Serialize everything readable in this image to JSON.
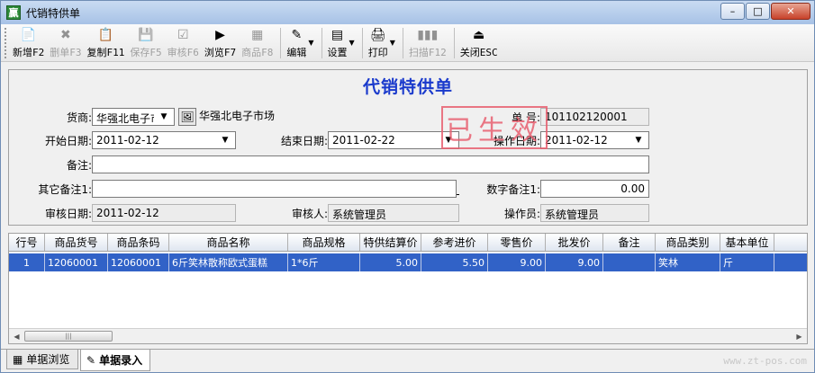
{
  "window": {
    "title": "代销特供单",
    "icon": "贏",
    "controls": {
      "minimize": "–",
      "maximize": "□",
      "close": "✕"
    }
  },
  "toolbar": [
    {
      "label": "新增F2",
      "icon": "📄",
      "enabled": true
    },
    {
      "label": "删单F3",
      "icon": "✖",
      "enabled": false
    },
    {
      "label": "复制F11",
      "icon": "📋",
      "enabled": true
    },
    {
      "label": "保存F5",
      "icon": "💾",
      "enabled": false
    },
    {
      "label": "审核F6",
      "icon": "☑",
      "enabled": false
    },
    {
      "label": "浏览F7",
      "icon": "▶",
      "enabled": true
    },
    {
      "label": "商品F8",
      "icon": "▦",
      "enabled": false
    },
    {
      "label": "编辑",
      "icon": "✎",
      "enabled": true,
      "dropdown": true
    },
    {
      "label": "设置",
      "icon": "▤",
      "enabled": true,
      "dropdown": true
    },
    {
      "label": "打印",
      "icon": "🖨",
      "enabled": true,
      "dropdown": true
    },
    {
      "label": "扫描F12",
      "icon": "▮▮▮",
      "enabled": false
    },
    {
      "label": "关闭ESC",
      "icon": "⏏",
      "enabled": true
    }
  ],
  "form": {
    "title": "代销特供单",
    "supplier_label": "货商:",
    "supplier_value": "华强北电子市",
    "supplier_name": "华强北电子市场",
    "docno_label": "单 号:",
    "docno_value": "101102120001",
    "start_label": "开始日期:",
    "start_value": "2011-02-12",
    "end_label": "结束日期:",
    "end_value": "2011-02-22",
    "opdate_label": "操作日期:",
    "opdate_value": "2011-02-12",
    "remark_label": "备注:",
    "remark_value": "",
    "other_label": "其它备注1:",
    "other_value": "",
    "num_label": "数字备注1:",
    "num_value": "0.00",
    "audit_date_label": "审核日期:",
    "audit_date_value": "2011-02-12",
    "auditor_label": "审核人:",
    "auditor_value": "系统管理员",
    "operator_label": "操作员:",
    "operator_value": "系统管理员",
    "stamp_text": "已生效",
    "stamp_color": "#e86070"
  },
  "grid": {
    "columns": [
      "行号",
      "商品货号",
      "商品条码",
      "商品名称",
      "商品规格",
      "特供结算价",
      "参考进价",
      "零售价",
      "批发价",
      "备注",
      "商品类别",
      "基本单位"
    ],
    "rows": [
      [
        "1",
        "12060001",
        "12060001",
        "6斤笑林散称欧式蛋糕",
        "1*6斤",
        "5.00",
        "5.50",
        "9.00",
        "9.00",
        "",
        "笑林",
        "斤"
      ]
    ]
  },
  "tabs": [
    {
      "label": "单据浏览",
      "icon": "▦",
      "active": false
    },
    {
      "label": "单据录入",
      "icon": "✎",
      "active": true
    }
  ],
  "watermark": "www.zt-pos.com"
}
